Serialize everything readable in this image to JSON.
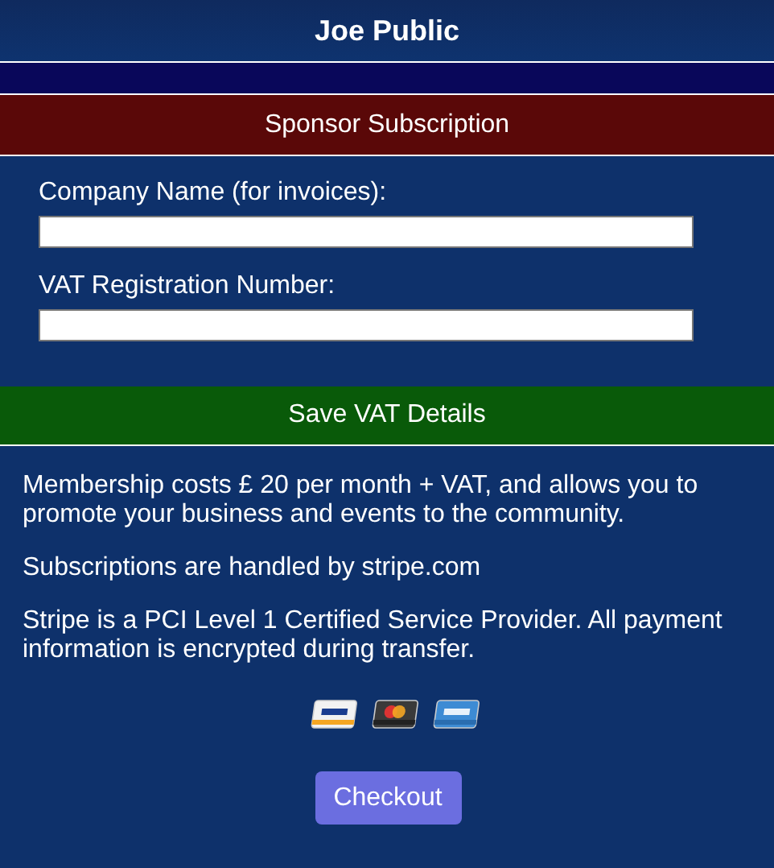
{
  "header": {
    "title": "Joe Public"
  },
  "section": {
    "title": "Sponsor Subscription"
  },
  "form": {
    "fields": [
      {
        "label": "Company Name (for invoices):"
      },
      {
        "label": "VAT Registration Number:"
      }
    ]
  },
  "save_button": "Save VAT Details",
  "paragraphs": [
    "Membership costs £ 20 per month + VAT, and allows you to promote your business and events to the community.",
    "Subscriptions are handled by stripe.com",
    "Stripe is a PCI Level 1 Certified Service Provider. All payment information is encrypted during transfer."
  ],
  "cards": [
    {
      "kind": "visa"
    },
    {
      "kind": "mastercard"
    },
    {
      "kind": "amex"
    }
  ],
  "checkout_button": "Checkout"
}
